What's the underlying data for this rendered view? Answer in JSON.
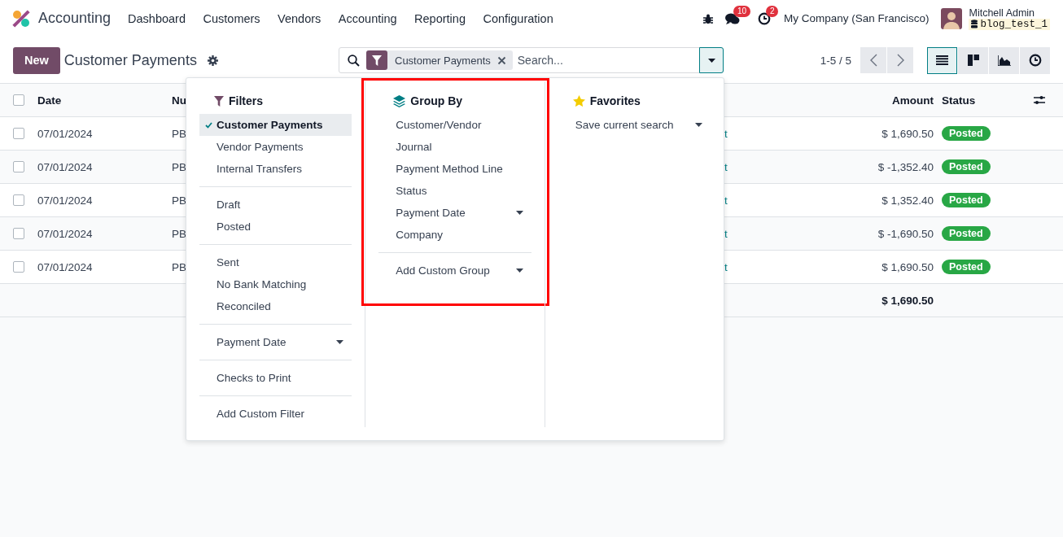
{
  "navbar": {
    "app_name": "Accounting",
    "menu": [
      {
        "label": "Dashboard"
      },
      {
        "label": "Customers"
      },
      {
        "label": "Vendors"
      },
      {
        "label": "Accounting"
      },
      {
        "label": "Reporting"
      },
      {
        "label": "Configuration"
      }
    ],
    "messages_badge": "10",
    "activities_badge": "2",
    "company": "My Company (San Francisco)",
    "user": {
      "name": "Mitchell Admin",
      "database": "blog_test_1"
    }
  },
  "control_panel": {
    "new_button": "New",
    "title": "Customer Payments",
    "search": {
      "facet": "Customer Payments",
      "placeholder": "Search..."
    },
    "pager": "1-5 / 5",
    "views": [
      {
        "kind": "list",
        "selected": true
      },
      {
        "kind": "kanban",
        "selected": false
      },
      {
        "kind": "graph",
        "selected": false
      },
      {
        "kind": "activity",
        "selected": false
      }
    ]
  },
  "table": {
    "all_checked": false,
    "columns": {
      "date": "Date",
      "number": "Nu",
      "amount": "Amount",
      "status": "Status"
    },
    "rows": [
      {
        "checked": false,
        "date": "07/01/2024",
        "number": "PB",
        "column_3": "t",
        "amount": "$ 1,690.50",
        "status": "Posted"
      },
      {
        "checked": false,
        "date": "07/01/2024",
        "number": "PB",
        "column_3": "t",
        "amount": "$ -1,352.40",
        "status": "Posted"
      },
      {
        "checked": false,
        "date": "07/01/2024",
        "number": "PB",
        "column_3": "t",
        "amount": "$ 1,352.40",
        "status": "Posted"
      },
      {
        "checked": false,
        "date": "07/01/2024",
        "number": "PB",
        "column_3": "t",
        "amount": "$ -1,690.50",
        "status": "Posted"
      },
      {
        "checked": false,
        "date": "07/01/2024",
        "number": "PB",
        "column_3": "t",
        "amount": "$ 1,690.50",
        "status": "Posted"
      }
    ],
    "total": "$ 1,690.50"
  },
  "search_panel": {
    "filters": {
      "title": "Filters",
      "highlighted": false,
      "groups": [
        [
          {
            "label": "Customer Payments",
            "checked": true,
            "kind": "option"
          },
          {
            "label": "Vendor Payments",
            "checked": false,
            "kind": "option"
          },
          {
            "label": "Internal Transfers",
            "checked": false,
            "kind": "option"
          }
        ],
        [
          {
            "label": "Draft",
            "checked": false,
            "kind": "option"
          },
          {
            "label": "Posted",
            "checked": false,
            "kind": "option"
          }
        ],
        [
          {
            "label": "Sent",
            "checked": false,
            "kind": "option"
          },
          {
            "label": "No Bank Matching",
            "checked": false,
            "kind": "option"
          },
          {
            "label": "Reconciled",
            "checked": false,
            "kind": "option"
          }
        ],
        [
          {
            "label": "Payment Date",
            "checked": false,
            "kind": "submenu"
          }
        ],
        [
          {
            "label": "Checks to Print",
            "checked": false,
            "kind": "option"
          }
        ],
        [
          {
            "label": "Add Custom Filter",
            "checked": false,
            "kind": "option"
          }
        ]
      ]
    },
    "group_by": {
      "title": "Group By",
      "highlighted": true,
      "groups": [
        [
          {
            "label": "Customer/Vendor",
            "checked": false,
            "kind": "option"
          },
          {
            "label": "Journal",
            "checked": false,
            "kind": "option"
          },
          {
            "label": "Payment Method Line",
            "checked": false,
            "kind": "option"
          },
          {
            "label": "Status",
            "checked": false,
            "kind": "option"
          },
          {
            "label": "Payment Date",
            "checked": false,
            "kind": "submenu"
          },
          {
            "label": "Company",
            "checked": false,
            "kind": "option"
          }
        ],
        [
          {
            "label": "Add Custom Group",
            "checked": false,
            "kind": "submenu"
          }
        ]
      ]
    },
    "favorites": {
      "title": "Favorites",
      "highlighted": false,
      "groups": [
        [
          {
            "label": "Save current search",
            "checked": false,
            "kind": "submenu"
          }
        ]
      ]
    }
  }
}
